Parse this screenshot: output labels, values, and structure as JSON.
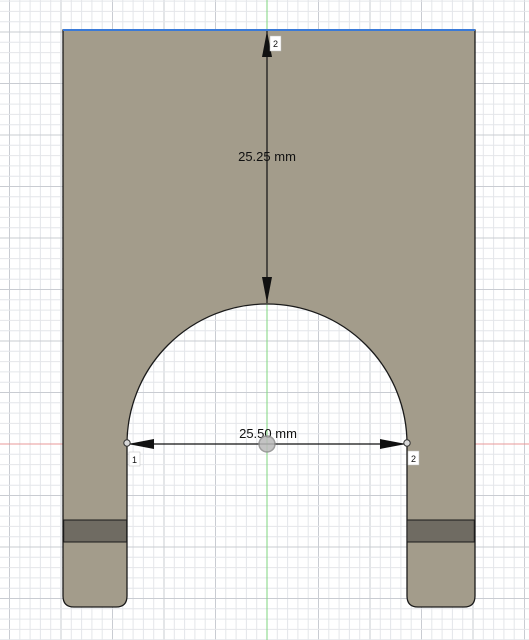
{
  "canvas": {
    "background": "#ffffff",
    "grid_minor_color": "#e4e6ea",
    "grid_major_color": "#c9ccd2",
    "x_axis_color": "#e89a9a",
    "y_axis_color": "#7fd67f"
  },
  "part": {
    "fill_color": "#a39c8b",
    "band_color": "#6f6b62",
    "outline_color": "#1a1a1a",
    "top_edge_color": "#3a7ad8"
  },
  "dimensions": {
    "vertical_label": "25.25 mm",
    "horizontal_label": "25.50 mm"
  },
  "points": {
    "top_label": "2",
    "left_label": "1",
    "right_label": "2"
  },
  "icons": {
    "origin": "origin-circle-icon",
    "point": "sketch-point-icon"
  }
}
